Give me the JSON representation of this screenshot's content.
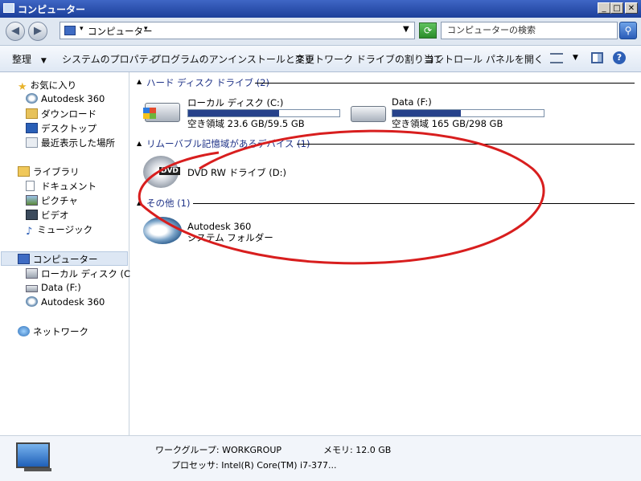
{
  "window": {
    "title": "コンピューター"
  },
  "address": {
    "path": "コンピューター",
    "search_placeholder": "コンピューターの検索"
  },
  "toolbar": {
    "organize": "整理",
    "system_properties": "システムのプロパティ",
    "uninstall": "プログラムのアンインストールと変更",
    "map_drive": "ネットワーク ドライブの割り当て",
    "control_panel": "コントロール パネルを開く"
  },
  "nav": {
    "favorites": "お気に入り",
    "favorites_items": [
      "Autodesk 360",
      "ダウンロード",
      "デスクトップ",
      "最近表示した場所"
    ],
    "libraries": "ライブラリ",
    "libraries_items": [
      "ドキュメント",
      "ピクチャ",
      "ビデオ",
      "ミュージック"
    ],
    "computer": "コンピューター",
    "computer_items": [
      "ローカル ディスク (C:)",
      "Data (F:)",
      "Autodesk 360"
    ],
    "network": "ネットワーク"
  },
  "groups": {
    "hdd": "ハード ディスク ドライブ (2)",
    "removable": "リムーバブル記憶域があるデバイス (1)",
    "other": "その他 (1)"
  },
  "drives": {
    "c": {
      "name": "ローカル ディスク (C:)",
      "free": "空き領域 23.6 GB/59.5 GB",
      "used_fraction": 0.6
    },
    "f": {
      "name": "Data (F:)",
      "free": "空き領域 165 GB/298 GB",
      "used_fraction": 0.45
    },
    "dvd": {
      "name": "DVD RW ドライブ (D:)",
      "badge": "DVD"
    },
    "a360": {
      "name": "Autodesk 360",
      "type": "システム フォルダー"
    }
  },
  "status": {
    "workgroup": "ワークグループ: WORKGROUP",
    "memory": "メモリ: 12.0 GB",
    "processor": "プロセッサ: Intel(R) Core(TM) i7-377..."
  },
  "colors": {
    "accent": "#26428b",
    "annotation": "#d81e1e"
  }
}
